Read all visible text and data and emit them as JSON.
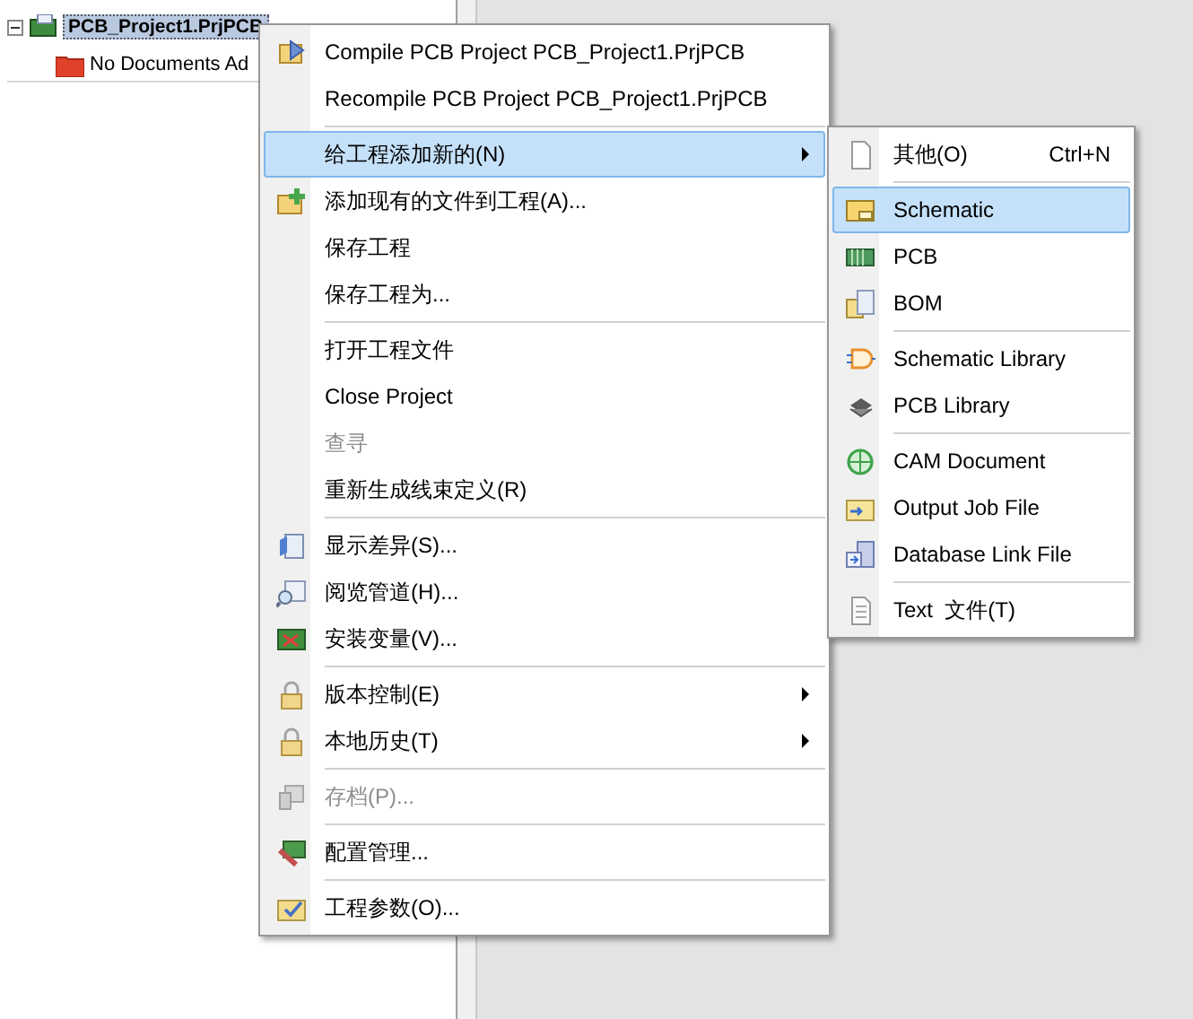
{
  "tree": {
    "project": {
      "label": "PCB_Project1.PrjPCB",
      "expanded": true,
      "selected": true
    },
    "children": [
      {
        "label": "No Documents Ad"
      }
    ]
  },
  "context_menu": {
    "items": [
      {
        "kind": "item",
        "label": "Compile PCB Project PCB_Project1.PrjPCB",
        "disabled": false,
        "selected": false,
        "submenu": false
      },
      {
        "kind": "item",
        "label": "Recompile PCB Project PCB_Project1.PrjPCB",
        "disabled": false,
        "selected": false,
        "submenu": false
      },
      {
        "kind": "separator"
      },
      {
        "kind": "item",
        "label": "给工程添加新的(N)",
        "disabled": false,
        "selected": true,
        "submenu": true
      },
      {
        "kind": "item",
        "label": "添加现有的文件到工程(A)...",
        "disabled": false,
        "selected": false,
        "submenu": false
      },
      {
        "kind": "item",
        "label": "保存工程",
        "disabled": false,
        "selected": false,
        "submenu": false
      },
      {
        "kind": "item",
        "label": "保存工程为...",
        "disabled": false,
        "selected": false,
        "submenu": false
      },
      {
        "kind": "separator"
      },
      {
        "kind": "item",
        "label": "打开工程文件",
        "disabled": false,
        "selected": false,
        "submenu": false
      },
      {
        "kind": "item",
        "label": "Close Project",
        "disabled": false,
        "selected": false,
        "submenu": false
      },
      {
        "kind": "item",
        "label": "查寻",
        "disabled": true,
        "selected": false,
        "submenu": false
      },
      {
        "kind": "item",
        "label": "重新生成线束定义(R)",
        "disabled": false,
        "selected": false,
        "submenu": false
      },
      {
        "kind": "separator"
      },
      {
        "kind": "item",
        "label": "显示差异(S)...",
        "disabled": false,
        "selected": false,
        "submenu": false
      },
      {
        "kind": "item",
        "label": "阅览管道(H)...",
        "disabled": false,
        "selected": false,
        "submenu": false
      },
      {
        "kind": "item",
        "label": "安装变量(V)...",
        "disabled": false,
        "selected": false,
        "submenu": false
      },
      {
        "kind": "separator"
      },
      {
        "kind": "item",
        "label": "版本控制(E)",
        "disabled": false,
        "selected": false,
        "submenu": true
      },
      {
        "kind": "item",
        "label": "本地历史(T)",
        "disabled": false,
        "selected": false,
        "submenu": true
      },
      {
        "kind": "separator"
      },
      {
        "kind": "item",
        "label": "存档(P)...",
        "disabled": true,
        "selected": false,
        "submenu": false
      },
      {
        "kind": "separator"
      },
      {
        "kind": "item",
        "label": "配置管理...",
        "disabled": false,
        "selected": false,
        "submenu": false
      },
      {
        "kind": "separator"
      },
      {
        "kind": "item",
        "label": "工程参数(O)...",
        "disabled": false,
        "selected": false,
        "submenu": false
      }
    ]
  },
  "submenu": {
    "items": [
      {
        "kind": "item",
        "label": "其他(O)",
        "shortcut": "Ctrl+N",
        "selected": false
      },
      {
        "kind": "separator"
      },
      {
        "kind": "item",
        "label": "Schematic",
        "selected": true
      },
      {
        "kind": "item",
        "label": "PCB",
        "selected": false
      },
      {
        "kind": "item",
        "label": "BOM",
        "selected": false
      },
      {
        "kind": "separator"
      },
      {
        "kind": "item",
        "label": "Schematic Library",
        "selected": false
      },
      {
        "kind": "item",
        "label": "PCB Library",
        "selected": false
      },
      {
        "kind": "separator"
      },
      {
        "kind": "item",
        "label": "CAM Document",
        "selected": false
      },
      {
        "kind": "item",
        "label": "Output Job File",
        "selected": false
      },
      {
        "kind": "item",
        "label": "Database Link File",
        "selected": false
      },
      {
        "kind": "separator"
      },
      {
        "kind": "item",
        "label": "Text  文件(T)",
        "selected": false
      }
    ]
  }
}
